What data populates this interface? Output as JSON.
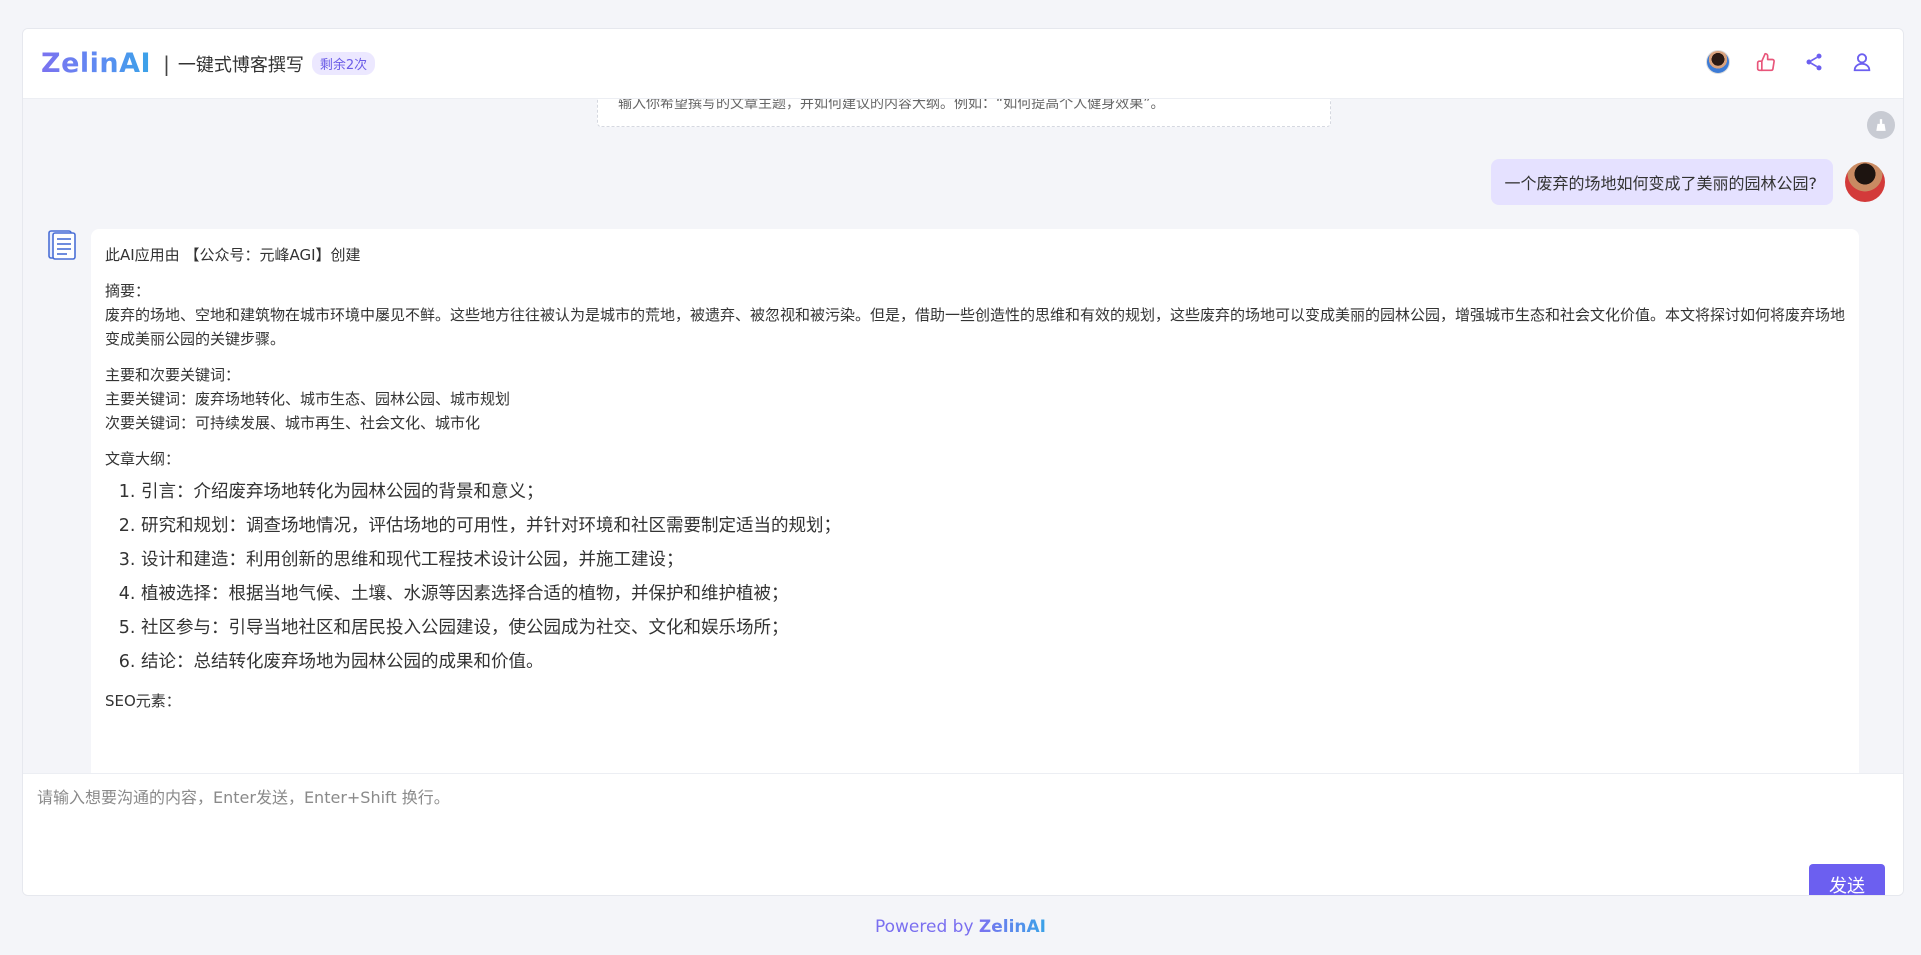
{
  "header": {
    "logo": "ZelinAI",
    "separator": "|",
    "title": "一键式博客撰写",
    "badge": "剩余2次"
  },
  "icons": {
    "avatar": "user-avatar-icon",
    "like": "thumbs-up-icon",
    "share": "share-icon",
    "profile": "user-icon",
    "clear": "broom-icon",
    "bot": "document-icon"
  },
  "welcome": {
    "text": "输入你希望撰写的文章主题，并如何建议的内容大纲。例如：“如何提高个人健身效果”。"
  },
  "user_message": {
    "text": "一个废弃的场地如何变成了美丽的园林公园?"
  },
  "bot_message": {
    "credit": "此AI应用由 【公众号：元峰AGI】创建",
    "summary_label": "摘要：",
    "summary": "废弃的场地、空地和建筑物在城市环境中屡见不鲜。这些地方往往被认为是城市的荒地，被遗弃、被忽视和被污染。但是，借助一些创造性的思维和有效的规划，这些废弃的场地可以变成美丽的园林公园，增强城市生态和社会文化价值。本文将探讨如何将废弃场地变成美丽公园的关键步骤。",
    "keywords_label": "主要和次要关键词：",
    "primary_keywords": "主要关键词：废弃场地转化、城市生态、园林公园、城市规划",
    "secondary_keywords": "次要关键词：可持续发展、城市再生、社会文化、城市化",
    "outline_label": "文章大纲：",
    "outline": [
      "引言：介绍废弃场地转化为园林公园的背景和意义；",
      "研究和规划：调查场地情况，评估场地的可用性，并针对环境和社区需要制定适当的规划；",
      "设计和建造：利用创新的思维和现代工程技术设计公园，并施工建设；",
      "植被选择：根据当地气候、土壤、水源等因素选择合适的植物，并保护和维护植被；",
      "社区参与：引导当地社区和居民投入公园建设，使公园成为社交、文化和娱乐场所；",
      "结论：总结转化废弃场地为园林公园的成果和价值。"
    ],
    "seo_label": "SEO元素："
  },
  "input": {
    "placeholder": "请输入想要沟通的内容，Enter发送，Enter+Shift 换行。",
    "value": ""
  },
  "send_label": "发送",
  "footer": {
    "prefix": "Powered by ",
    "brand": "ZelinAI"
  },
  "colors": {
    "accent": "#6c5ff0",
    "user_bubble": "#e5e1ff",
    "badge_bg": "#ece8ff",
    "like_icon": "#e8557a",
    "share_icon": "#6c5ff0"
  }
}
